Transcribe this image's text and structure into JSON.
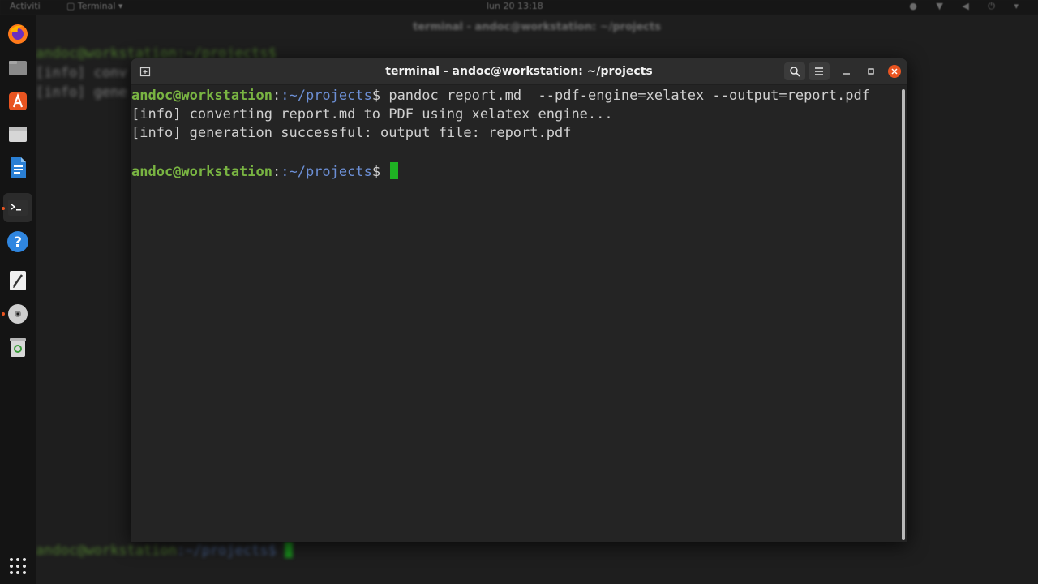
{
  "topbar": {
    "activities": "Activiti",
    "app_name": "Terminal",
    "clock": "lun 20 13:18"
  },
  "dock": {
    "items": [
      {
        "name": "firefox-icon"
      },
      {
        "name": "files-icon"
      },
      {
        "name": "software-icon"
      },
      {
        "name": "folder-icon"
      },
      {
        "name": "writer-icon"
      },
      {
        "name": "terminal-icon"
      },
      {
        "name": "help-icon"
      },
      {
        "name": "text-editor-icon"
      },
      {
        "name": "disc-icon"
      },
      {
        "name": "trash-icon"
      },
      {
        "name": "apps-grid-icon"
      }
    ]
  },
  "background_terminal": {
    "title": "terminal - andoc@workstation: ~/projects",
    "lines": [
      "andoc@workstation:~/projects$",
      "[info] conv",
      "[info] gene"
    ],
    "bottom_prompt_user": "andoc@workstation",
    "bottom_prompt_path": ":~/projects$"
  },
  "window": {
    "title": "terminal - andoc@workstation: ~/projects"
  },
  "terminal": {
    "prompt_user": "andoc@workstation",
    "prompt_path": ":~/projects",
    "prompt_symbol": "$",
    "command": " pandoc report.md  --pdf-engine=xelatex --output=report.pdf",
    "output": [
      "[info] converting report.md to PDF using xelatex engine...",
      "[info] generation successful: output file: report.pdf"
    ]
  },
  "colors": {
    "prompt_user": "#79b442",
    "prompt_path": "#6c8fd5",
    "cursor": "#1fb223",
    "close_button": "#e95420",
    "terminal_bg": "#242424"
  }
}
